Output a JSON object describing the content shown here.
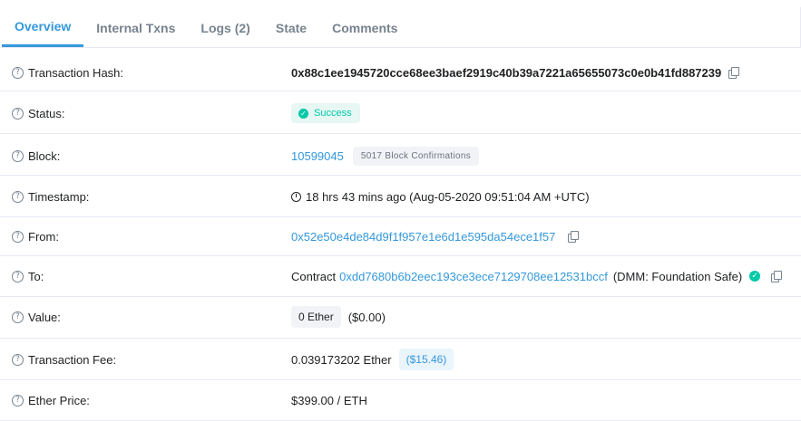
{
  "tabs": [
    {
      "label": "Overview"
    },
    {
      "label": "Internal Txns"
    },
    {
      "label": "Logs (2)"
    },
    {
      "label": "State"
    },
    {
      "label": "Comments"
    }
  ],
  "rows": {
    "tx_hash": {
      "label": "Transaction Hash:",
      "value": "0x88c1ee1945720cce68ee3baef2919c40b39a7221a65655073c0e0b41fd887239"
    },
    "status": {
      "label": "Status:",
      "value": "Success"
    },
    "block": {
      "label": "Block:",
      "value": "10599045",
      "confirmations": "5017 Block Confirmations"
    },
    "timestamp": {
      "label": "Timestamp:",
      "value": "18 hrs 43 mins ago (Aug-05-2020 09:51:04 AM +UTC)"
    },
    "from": {
      "label": "From:",
      "value": "0x52e50e4de84d9f1f957e1e6d1e595da54ece1f57"
    },
    "to": {
      "label": "To:",
      "prefix": "Contract",
      "value": "0xdd7680b6b2eec193ce3ece7129708ee12531bccf",
      "name": "(DMM: Foundation Safe)"
    },
    "value": {
      "label": "Value:",
      "amount": "0 Ether",
      "usd": "($0.00)"
    },
    "fee": {
      "label": "Transaction Fee:",
      "amount": "0.039173202 Ether",
      "usd": "($15.46)"
    },
    "ether_price": {
      "label": "Ether Price:",
      "value": "$399.00 / ETH"
    }
  },
  "icons": {
    "help": "question-circle-icon",
    "copy": "copy-icon",
    "check": "check-circle-icon",
    "clock": "clock-icon"
  },
  "colors": {
    "accent": "#3498db",
    "success": "#00c9a7",
    "text": "#1e2022",
    "muted": "#77838f"
  }
}
